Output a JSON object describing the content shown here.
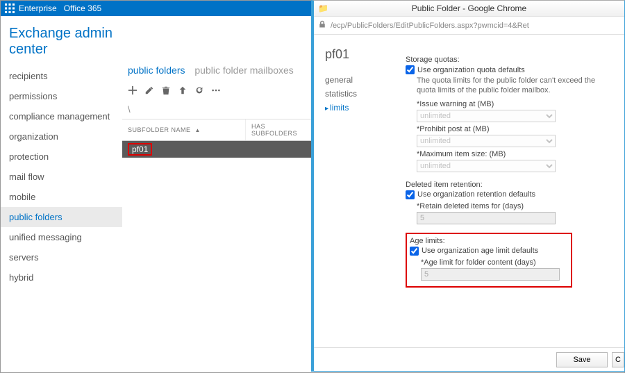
{
  "topbar": {
    "enterprise": "Enterprise",
    "o365": "Office 365"
  },
  "eac_title": "Exchange admin center",
  "leftnav": [
    "recipients",
    "permissions",
    "compliance management",
    "organization",
    "protection",
    "mail flow",
    "mobile",
    "public folders",
    "unified messaging",
    "servers",
    "hybrid"
  ],
  "leftnav_selected_index": 7,
  "tabs": {
    "active": "public folders",
    "inactive": "public folder mailboxes"
  },
  "icons": {
    "plus": "plus-icon",
    "edit": "pencil-icon",
    "delete": "trash-icon",
    "up": "arrow-up-icon",
    "refresh": "refresh-icon",
    "more": "ellipsis-icon"
  },
  "breadcrumb": "\\",
  "grid": {
    "col1": "SUBFOLDER NAME",
    "col2": "HAS SUBFOLDERS",
    "sort_caret": "▲",
    "rows": [
      {
        "name": "pf01",
        "has": ""
      }
    ]
  },
  "popup": {
    "window_title": "Public Folder - Google Chrome",
    "url": "/ecp/PublicFolders/EditPublicFolders.aspx?pwmcid=4&Ret",
    "edit_title": "pf01",
    "nav": [
      "general",
      "statistics",
      "limits"
    ],
    "nav_selected_index": 2,
    "storage": {
      "title": "Storage quotas:",
      "use_defaults": "Use organization quota defaults",
      "hint": "The quota limits for the public folder can't exceed the quota limits of the public folder mailbox.",
      "issue_label": "*Issue warning at (MB)",
      "prohibit_label": "*Prohibit post at (MB)",
      "maxitem_label": "*Maximum item size: (MB)",
      "unlimited": "unlimited"
    },
    "retention": {
      "title": "Deleted item retention:",
      "use_defaults": "Use organization retention defaults",
      "retain_label": "*Retain deleted items for (days)",
      "retain_value": "5"
    },
    "age": {
      "title": "Age limits:",
      "use_defaults": "Use organization age limit defaults",
      "age_label": "*Age limit for folder content (days)",
      "age_value": "5"
    },
    "footer": {
      "save": "Save",
      "cancel": "C"
    }
  }
}
